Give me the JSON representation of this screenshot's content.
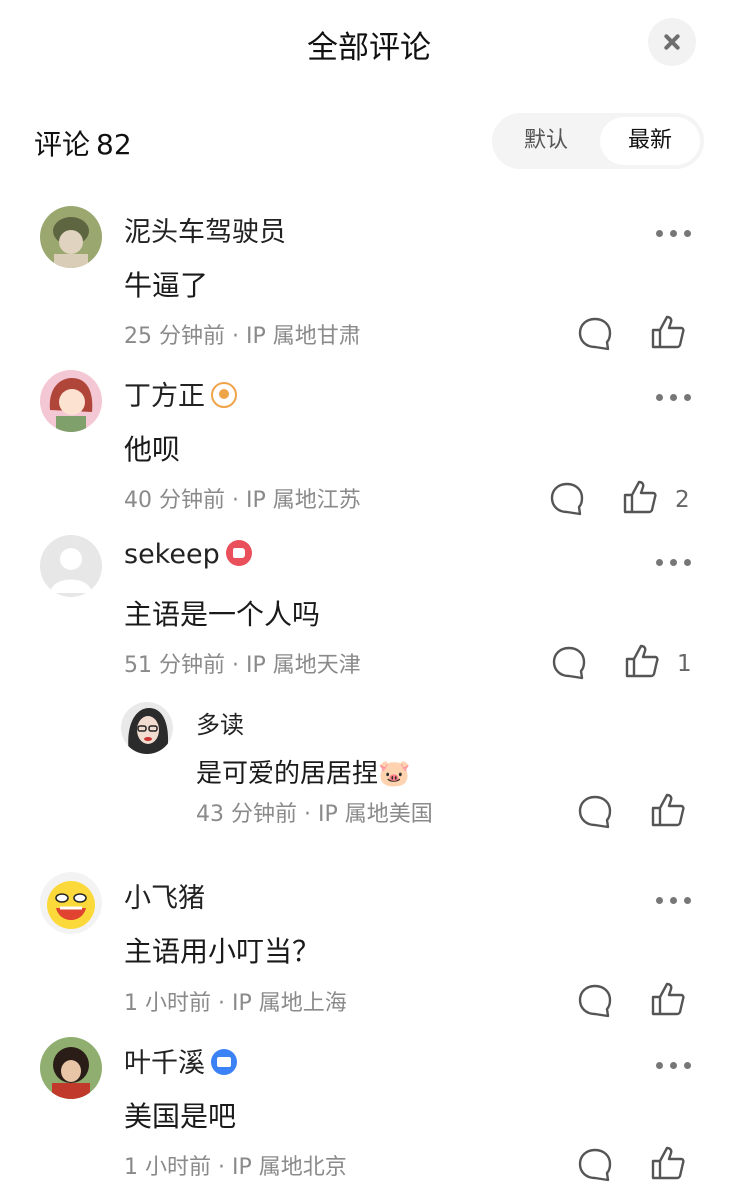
{
  "header": {
    "title": "全部评论",
    "close_icon": "close-icon"
  },
  "summary": {
    "label": "评论",
    "count": "82"
  },
  "sort": {
    "options": [
      "默认",
      "最新"
    ],
    "selected": "最新"
  },
  "comments": [
    {
      "name": "泥头车驾驶员",
      "badge": null,
      "text": "牛逼了",
      "time": "25 分钟前",
      "location": "IP 属地甘肃",
      "likes": ""
    },
    {
      "name": "丁方正",
      "badge": "orange-user-badge",
      "text": "他呗",
      "time": "40 分钟前",
      "location": "IP 属地江苏",
      "likes": "2"
    },
    {
      "name": "sekeep",
      "badge": "red-like-badge",
      "text": "主语是一个人吗",
      "time": "51 分钟前",
      "location": "IP 属地天津",
      "likes": "1",
      "reply": {
        "name": "多读",
        "text": "是可爱的居居捏🐷",
        "time": "43 分钟前",
        "location": "IP 属地美国"
      }
    },
    {
      "name": "小飞猪",
      "badge": null,
      "text": "主语用小叮当？",
      "time": "1 小时前",
      "location": "IP 属地上海",
      "likes": ""
    },
    {
      "name": "叶千溪",
      "badge": "blue-mail-badge",
      "text": "美国是吧",
      "time": "1 小时前",
      "location": "IP 属地北京",
      "likes": ""
    }
  ],
  "separator": "·",
  "colors": {
    "meta_gray": "#8a8a8a",
    "accent_red": "#ea4f5c",
    "accent_orange": "#f0a44a",
    "accent_blue": "#3b82f6"
  }
}
